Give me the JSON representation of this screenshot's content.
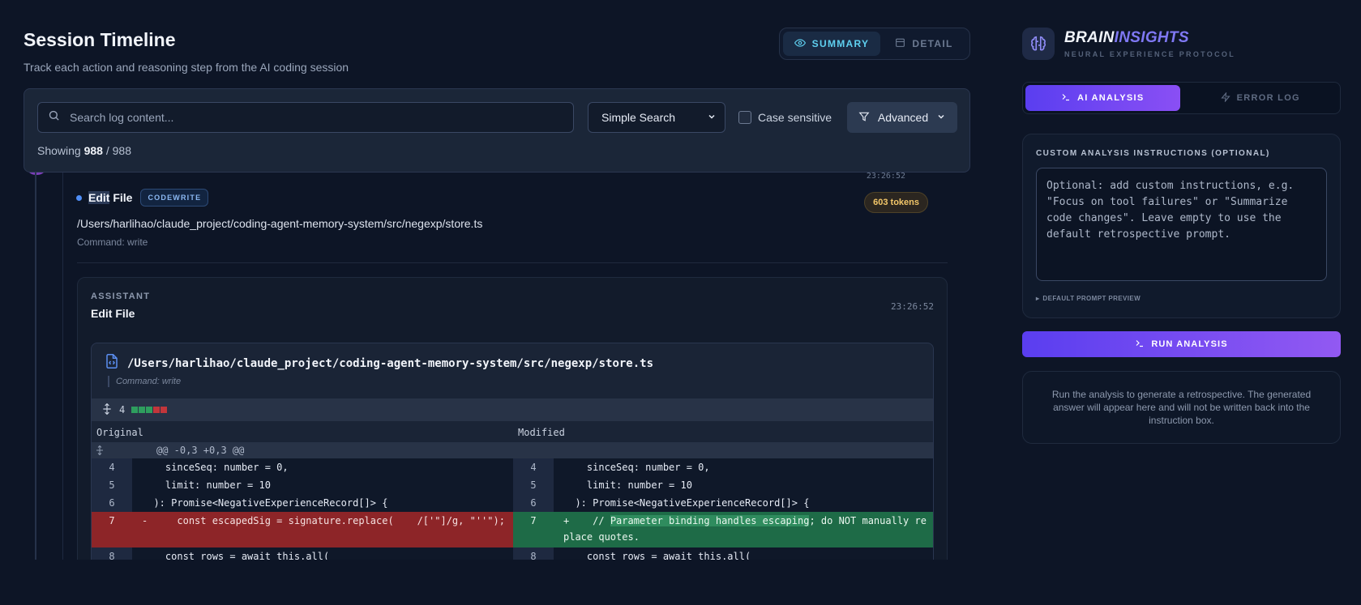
{
  "header": {
    "title": "Session Timeline",
    "subtitle": "Track each action and reasoning step from the AI coding session"
  },
  "view_toggle": {
    "summary_label": "SUMMARY",
    "detail_label": "DETAIL"
  },
  "search": {
    "placeholder": "Search log content...",
    "mode_selected": "Simple Search",
    "case_label": "Case sensitive",
    "advanced_label": "Advanced",
    "showing_prefix": "Showing",
    "showing_count": "988",
    "showing_sep": "/",
    "showing_total": "988"
  },
  "entry": {
    "time_top": "23:26:52",
    "title_highlight": "Edit",
    "title_rest": " File",
    "tag": "CODEWRITE",
    "tokens": "603 tokens",
    "path": "/Users/harlihao/claude_project/coding-agent-memory-system/src/negexp/store.ts",
    "command": "Command: write"
  },
  "assistant": {
    "role": "ASSISTANT",
    "title": "Edit File",
    "time": "23:26:52",
    "diff": {
      "path": "/Users/harlihao/claude_project/coding-agent-memory-system/src/negexp/store.ts",
      "command": "Command: write",
      "change_count": "4",
      "original_label": "Original",
      "modified_label": "Modified",
      "hunk": "@@ -0,3 +0,3 @@",
      "rows": [
        {
          "l_num": "4",
          "l_code": "    sinceSeq: number = 0,",
          "r_num": "4",
          "r_code": "    sinceSeq: number = 0,"
        },
        {
          "l_num": "5",
          "l_code": "    limit: number = 10",
          "r_num": "5",
          "r_code": "    limit: number = 10"
        },
        {
          "l_num": "6",
          "l_code": "  ): Promise<NegativeExperienceRecord[]> {",
          "r_num": "6",
          "r_code": "  ): Promise<NegativeExperienceRecord[]> {"
        },
        {
          "l_num": "7",
          "l_sign": "-",
          "l_code": "    const escapedSig = signature.replace(    /['\"]/g, \"''\");",
          "r_num": "7",
          "r_sign": "+",
          "r_code_pre": "    // ",
          "r_code_hl": "Parameter binding handles escaping",
          "r_code_post": "; do NOT manually replace quotes."
        },
        {
          "l_num": "8",
          "l_code": "    const rows = await this.all(",
          "r_num": "8",
          "r_code": "    const rows = await this.all("
        }
      ]
    }
  },
  "brand": {
    "name_a": "BRAIN",
    "name_b": "INSIGHTS",
    "subtitle": "NEURAL EXPERIENCE PROTOCOL"
  },
  "right_tabs": {
    "ai_analysis": "AI ANALYSIS",
    "error_log": "ERROR LOG"
  },
  "instructions": {
    "label": "CUSTOM ANALYSIS INSTRUCTIONS (OPTIONAL)",
    "placeholder": "Optional: add custom instructions, e.g. \"Focus on tool failures\" or \"Summarize code changes\". Leave empty to use the default retrospective prompt.",
    "preview_label": "DEFAULT PROMPT PREVIEW"
  },
  "run_button": "RUN ANALYSIS",
  "note": "Run the analysis to generate a retrospective. The generated answer will appear here and will not be written back into the instruction box.",
  "colors": {
    "background": "#0d1526",
    "accent": "#6c4ef2",
    "summary_active": "#5fd0f0",
    "token_badge": "#f3c769",
    "diff_removed": "#8d2528",
    "diff_added": "#1e6b47"
  }
}
